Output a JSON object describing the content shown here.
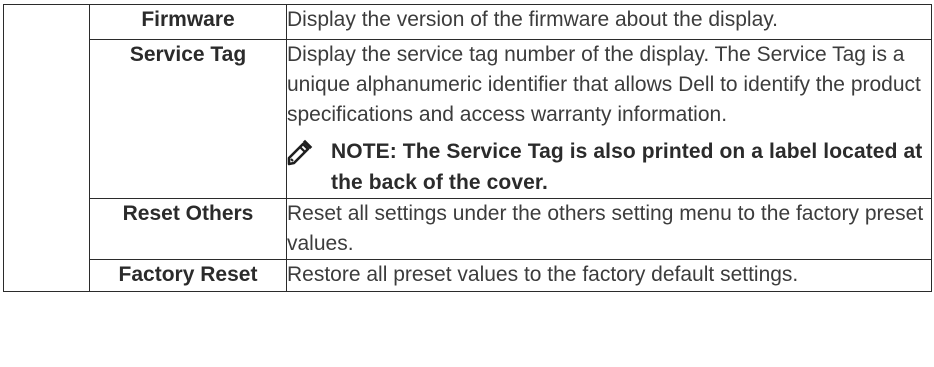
{
  "rows": [
    {
      "label": "Firmware",
      "description": "Display the version of the firmware about the display."
    },
    {
      "label": "Service Tag",
      "description": "Display the service tag number of the display. The Service Tag is a unique alphanumeric identifier that allows Dell to identify the product specifications and access warranty information.",
      "note": "NOTE: The Service Tag is also printed on a label located at the back of the cover.",
      "note_icon": "pencil-note-icon"
    },
    {
      "label": "Reset Others",
      "description": "Reset all settings under the others setting menu to the factory preset values."
    },
    {
      "label": "Factory Reset",
      "description": "Restore all preset values to the factory default settings."
    }
  ]
}
